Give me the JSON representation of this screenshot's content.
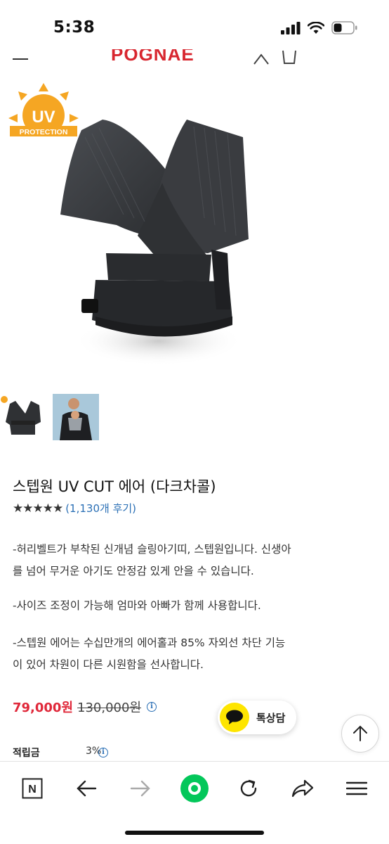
{
  "status_bar": {
    "time": "5:38",
    "icons": [
      "signal-icon",
      "wifi-icon",
      "battery-icon"
    ]
  },
  "header": {
    "brand": "POGNAE",
    "icons": [
      "menu-icon",
      "user-icon",
      "cart-icon"
    ],
    "brand_color": "#d8262f"
  },
  "product_image": {
    "badge_main": "UV",
    "badge_sub": "PROTECTION",
    "badge_color": "#f5a623"
  },
  "thumbnails": [
    "product-thumbnail-carrier",
    "product-thumbnail-model"
  ],
  "product": {
    "title": "스텝원 UV CUT 에어 (다크차콜)",
    "stars": "★★★★★",
    "reviews": "(1,130개 후기)",
    "description": [
      "-허리벨트가 부착된 신개념 슬링아기띠, 스텝원입니다. 신생아를 넘어 무거운 아기도 안정감 있게 안을 수 있습니다.",
      "-사이즈 조정이 가능해 엄마와 아빠가 함께 사용합니다.",
      "-스텝원 에어는 수십만개의 에어홀과 85% 자외선 차단 기능이 있어 차원이 다른 시원함을 선사합니다."
    ],
    "sale_price": "79,000원",
    "original_price": "130,000원",
    "info_glyph": "i",
    "points_label": "적립금",
    "points_value": "3%",
    "sale_color": "#e0283a",
    "link_color": "#2a6fb5"
  },
  "chat": {
    "label": "톡상담",
    "color": "#fee500"
  },
  "toolbar": {
    "items": [
      "naver-icon",
      "back-icon",
      "forward-icon",
      "green-home-icon",
      "refresh-icon",
      "share-icon",
      "menu-icon"
    ],
    "naver_letter": "N",
    "accent": "#03c75a"
  }
}
